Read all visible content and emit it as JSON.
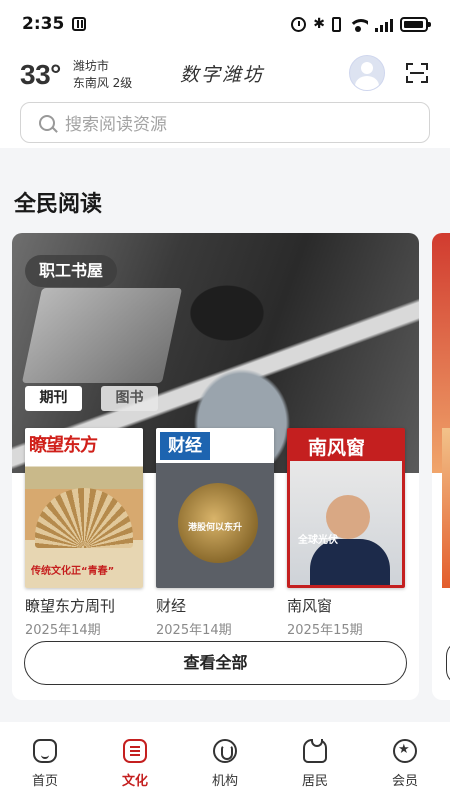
{
  "status_bar": {
    "time": "2:35",
    "battery_level": 0.95
  },
  "header": {
    "temperature": "33°",
    "city": "潍坊市",
    "wind": "东南风  2级",
    "title": "数字潍坊"
  },
  "search": {
    "placeholder": "搜索阅读资源"
  },
  "section": {
    "title": "全民阅读",
    "badge": "职工书屋",
    "tabs": [
      {
        "label": "期刊",
        "active": true
      },
      {
        "label": "图书",
        "active": false
      }
    ],
    "magazines": [
      {
        "name": "瞭望东方周刊",
        "issue": "2025年14期",
        "cover_title": "瞭望东方",
        "cover_sub": "传统文化正“青春”"
      },
      {
        "name": "财经",
        "issue": "2025年14期",
        "cover_title": "财经",
        "cover_sub": "港股何以东升"
      },
      {
        "name": "南风窗",
        "issue": "2025年15期",
        "cover_title": "南风窗",
        "cover_sub": "全球光伏"
      }
    ],
    "view_all": "查看全部"
  },
  "bottom_nav": [
    {
      "label": "首页",
      "icon": "home-icon",
      "active": false
    },
    {
      "label": "文化",
      "icon": "culture-icon",
      "active": true
    },
    {
      "label": "机构",
      "icon": "organization-icon",
      "active": false
    },
    {
      "label": "居民",
      "icon": "resident-icon",
      "active": false
    },
    {
      "label": "会员",
      "icon": "member-icon",
      "active": false
    }
  ],
  "colors": {
    "accent": "#c41f1f",
    "background": "#f4f5f7"
  }
}
